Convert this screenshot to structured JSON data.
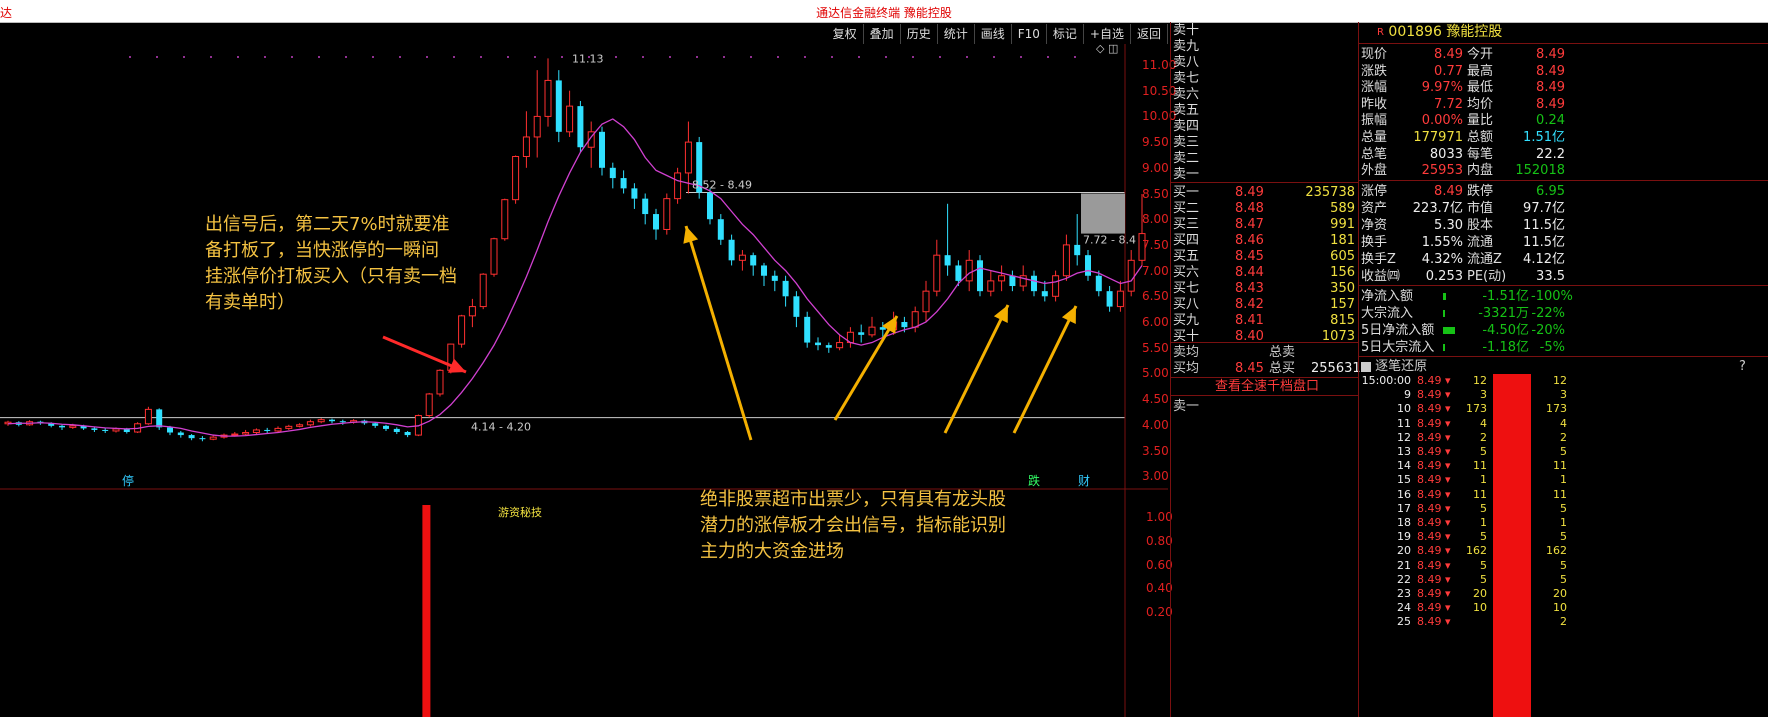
{
  "title_bar": {
    "text": "通达信金融终端  豫能控股",
    "edge": "达"
  },
  "toolbar": [
    "复权",
    "叠加",
    "历史",
    "统计",
    "画线",
    "F10",
    "标记",
    "+自选",
    "返回"
  ],
  "chart": {
    "high_label": "11.13",
    "range_label_low": "4.14 - 4.20",
    "range_label_high": "8.52 - 8.49",
    "right_label": "7.72 - 8.4",
    "markers": {
      "left": "停",
      "mid": "跌",
      "right": "财"
    },
    "indicator_title": "游资秘技",
    "annotation_left": [
      "出信号后，第二天7%时就要准",
      "备打板了，当快涨停的一瞬间",
      "挂涨停价打板买入（只有卖一档",
      "有卖单时）"
    ],
    "annotation_bottom": [
      "绝非股票超市出票少，只有具有龙头股",
      "潜力的涨停板才会出信号，指标能识别",
      "主力的大资金进场"
    ]
  },
  "chart_data": {
    "type": "candlestick",
    "price_axis": {
      "ticks": [
        "11.00",
        "10.50",
        "10.00",
        "9.50",
        "9.00",
        "8.50",
        "8.00",
        "7.50",
        "7.00",
        "6.50",
        "6.00",
        "5.50",
        "5.00",
        "4.50",
        "4.00",
        "3.50",
        "3.00"
      ],
      "min": 3.0,
      "max": 11.0
    },
    "indicator_axis": {
      "ticks": [
        "1.00",
        "0.80",
        "0.60",
        "0.40",
        "0.20"
      ]
    },
    "candles": [
      [
        4.02,
        4.05,
        3.98,
        4.08
      ],
      [
        4.05,
        4.0,
        3.97,
        4.07
      ],
      [
        4.0,
        4.06,
        3.98,
        4.09
      ],
      [
        4.06,
        4.03,
        4.0,
        4.08
      ],
      [
        4.03,
        3.98,
        3.95,
        4.05
      ],
      [
        3.98,
        3.95,
        3.9,
        4.0
      ],
      [
        3.95,
        3.98,
        3.92,
        4.02
      ],
      [
        3.98,
        3.93,
        3.9,
        4.0
      ],
      [
        3.93,
        3.9,
        3.86,
        3.96
      ],
      [
        3.9,
        3.88,
        3.84,
        3.94
      ],
      [
        3.88,
        3.92,
        3.85,
        3.95
      ],
      [
        3.92,
        3.86,
        3.83,
        3.94
      ],
      [
        3.86,
        4.02,
        3.84,
        4.05
      ],
      [
        4.02,
        4.3,
        4.0,
        4.35
      ],
      [
        4.3,
        3.95,
        3.9,
        4.32
      ],
      [
        3.95,
        3.85,
        3.8,
        3.98
      ],
      [
        3.85,
        3.8,
        3.75,
        3.88
      ],
      [
        3.8,
        3.74,
        3.7,
        3.82
      ],
      [
        3.74,
        3.72,
        3.68,
        3.78
      ],
      [
        3.72,
        3.76,
        3.7,
        3.8
      ],
      [
        3.76,
        3.8,
        3.73,
        3.83
      ],
      [
        3.8,
        3.82,
        3.77,
        3.86
      ],
      [
        3.82,
        3.85,
        3.8,
        3.9
      ],
      [
        3.85,
        3.9,
        3.82,
        3.93
      ],
      [
        3.9,
        3.88,
        3.84,
        3.94
      ],
      [
        3.88,
        3.93,
        3.85,
        3.97
      ],
      [
        3.93,
        3.97,
        3.9,
        4.0
      ],
      [
        3.97,
        4.0,
        3.95,
        4.03
      ],
      [
        4.0,
        4.06,
        3.97,
        4.1
      ],
      [
        4.06,
        4.1,
        4.03,
        4.13
      ],
      [
        4.1,
        4.07,
        4.03,
        4.12
      ],
      [
        4.07,
        4.05,
        4.0,
        4.1
      ],
      [
        4.05,
        4.08,
        4.02,
        4.11
      ],
      [
        4.08,
        4.03,
        4.0,
        4.1
      ],
      [
        4.03,
        3.98,
        3.94,
        4.05
      ],
      [
        3.98,
        3.92,
        3.88,
        4.0
      ],
      [
        3.92,
        3.86,
        3.82,
        3.95
      ],
      [
        3.86,
        3.8,
        3.76,
        3.88
      ],
      [
        3.8,
        4.18,
        3.78,
        4.2
      ],
      [
        4.18,
        4.6,
        4.14,
        4.62
      ],
      [
        4.6,
        5.06,
        4.55,
        5.08
      ],
      [
        5.06,
        5.57,
        5.0,
        5.58
      ],
      [
        5.57,
        6.12,
        5.5,
        6.14
      ],
      [
        6.12,
        6.3,
        5.9,
        6.45
      ],
      [
        6.3,
        6.93,
        6.25,
        6.95
      ],
      [
        6.93,
        7.62,
        6.88,
        7.64
      ],
      [
        7.62,
        8.38,
        7.58,
        8.4
      ],
      [
        8.38,
        9.22,
        8.3,
        9.24
      ],
      [
        9.22,
        9.6,
        9.0,
        10.1
      ],
      [
        9.6,
        10.0,
        9.2,
        10.9
      ],
      [
        10.0,
        10.7,
        9.8,
        11.13
      ],
      [
        10.7,
        9.7,
        9.5,
        10.9
      ],
      [
        9.7,
        10.2,
        9.6,
        10.5
      ],
      [
        10.2,
        9.4,
        9.3,
        10.3
      ],
      [
        9.4,
        9.7,
        9.0,
        9.9
      ],
      [
        9.7,
        9.0,
        8.85,
        9.8
      ],
      [
        9.0,
        8.8,
        8.6,
        9.1
      ],
      [
        8.8,
        8.6,
        8.5,
        8.95
      ],
      [
        8.6,
        8.4,
        8.2,
        8.7
      ],
      [
        8.4,
        8.1,
        7.9,
        8.5
      ],
      [
        8.1,
        7.8,
        7.6,
        8.2
      ],
      [
        7.8,
        8.4,
        7.7,
        8.5
      ],
      [
        8.4,
        8.9,
        8.3,
        9.0
      ],
      [
        8.9,
        9.5,
        8.5,
        9.9
      ],
      [
        9.5,
        8.52,
        8.4,
        9.6
      ],
      [
        8.52,
        8.0,
        7.9,
        8.6
      ],
      [
        8.0,
        7.6,
        7.5,
        8.1
      ],
      [
        7.6,
        7.2,
        7.1,
        7.7
      ],
      [
        7.2,
        7.3,
        7.0,
        7.4
      ],
      [
        7.3,
        7.1,
        6.9,
        7.35
      ],
      [
        7.1,
        6.9,
        6.7,
        7.15
      ],
      [
        6.9,
        6.8,
        6.6,
        7.0
      ],
      [
        6.8,
        6.5,
        6.3,
        6.9
      ],
      [
        6.5,
        6.1,
        5.9,
        6.6
      ],
      [
        6.1,
        5.6,
        5.5,
        6.2
      ],
      [
        5.6,
        5.55,
        5.45,
        5.7
      ],
      [
        5.55,
        5.5,
        5.4,
        5.6
      ],
      [
        5.5,
        5.6,
        5.45,
        5.75
      ],
      [
        5.6,
        5.8,
        5.5,
        5.9
      ],
      [
        5.8,
        5.75,
        5.6,
        5.95
      ],
      [
        5.75,
        5.9,
        5.7,
        6.1
      ],
      [
        5.9,
        5.85,
        5.7,
        6.0
      ],
      [
        5.85,
        6.0,
        5.75,
        6.2
      ],
      [
        6.0,
        5.9,
        5.8,
        6.1
      ],
      [
        5.9,
        6.2,
        5.8,
        6.3
      ],
      [
        6.2,
        6.6,
        6.0,
        6.8
      ],
      [
        6.6,
        7.3,
        6.5,
        7.6
      ],
      [
        7.3,
        7.1,
        6.9,
        8.3
      ],
      [
        7.1,
        6.8,
        6.7,
        7.2
      ],
      [
        6.8,
        7.2,
        6.6,
        7.4
      ],
      [
        7.2,
        6.6,
        6.5,
        7.3
      ],
      [
        6.6,
        6.8,
        6.5,
        7.0
      ],
      [
        6.8,
        6.9,
        6.6,
        7.1
      ],
      [
        6.9,
        6.7,
        6.6,
        7.0
      ],
      [
        6.7,
        6.9,
        6.6,
        7.1
      ],
      [
        6.9,
        6.6,
        6.5,
        7.0
      ],
      [
        6.6,
        6.5,
        6.4,
        6.8
      ],
      [
        6.5,
        6.9,
        6.4,
        7.0
      ],
      [
        6.9,
        7.5,
        6.8,
        7.7
      ],
      [
        7.5,
        7.3,
        7.1,
        8.1
      ],
      [
        7.3,
        6.9,
        6.8,
        7.4
      ],
      [
        6.9,
        6.6,
        6.5,
        7.0
      ],
      [
        6.6,
        6.3,
        6.2,
        6.7
      ],
      [
        6.3,
        6.6,
        6.2,
        6.8
      ],
      [
        6.6,
        7.2,
        6.5,
        7.4
      ],
      [
        7.2,
        7.72,
        7.1,
        8.49
      ]
    ],
    "ma": [
      4.02,
      4.03,
      4.03,
      4.04,
      4.03,
      4.01,
      4.0,
      3.98,
      3.96,
      3.94,
      3.93,
      3.92,
      3.93,
      3.97,
      3.98,
      3.96,
      3.93,
      3.88,
      3.84,
      3.8,
      3.78,
      3.78,
      3.79,
      3.81,
      3.83,
      3.85,
      3.88,
      3.91,
      3.95,
      3.98,
      4.01,
      4.03,
      4.05,
      4.06,
      4.05,
      4.03,
      4.0,
      3.96,
      3.98,
      4.07,
      4.2,
      4.39,
      4.63,
      4.9,
      5.21,
      5.55,
      5.95,
      6.4,
      6.88,
      7.4,
      7.95,
      8.45,
      8.9,
      9.3,
      9.6,
      9.85,
      9.95,
      9.8,
      9.55,
      9.2,
      8.95,
      8.85,
      8.75,
      8.7,
      8.65,
      8.55,
      8.4,
      8.15,
      7.9,
      7.7,
      7.45,
      7.2,
      7.0,
      6.75,
      6.45,
      6.2,
      5.95,
      5.75,
      5.6,
      5.55,
      5.6,
      5.7,
      5.78,
      5.85,
      5.9,
      6.0,
      6.2,
      6.45,
      6.75,
      6.95,
      7.05,
      7.0,
      6.95,
      6.9,
      6.85,
      6.8,
      6.75,
      6.78,
      6.85,
      6.95,
      7.0,
      6.95,
      6.85,
      6.75,
      6.8,
      7.1
    ],
    "indicator_bars": [
      {
        "index": 38,
        "value": 1.0
      }
    ]
  },
  "quote": {
    "code": "001896",
    "name": "豫能控股",
    "badge": "R",
    "ask_labels": [
      "卖十",
      "卖九",
      "卖八",
      "卖七",
      "卖六",
      "卖五",
      "卖四",
      "卖三",
      "卖二",
      "卖一"
    ],
    "bids": [
      {
        "label": "买一",
        "price": "8.49",
        "vol": "235738"
      },
      {
        "label": "买二",
        "price": "8.48",
        "vol": "589"
      },
      {
        "label": "买三",
        "price": "8.47",
        "vol": "991"
      },
      {
        "label": "买四",
        "price": "8.46",
        "vol": "181"
      },
      {
        "label": "买五",
        "price": "8.45",
        "vol": "605"
      },
      {
        "label": "买六",
        "price": "8.44",
        "vol": "156"
      },
      {
        "label": "买七",
        "price": "8.43",
        "vol": "350"
      },
      {
        "label": "买八",
        "price": "8.42",
        "vol": "157"
      },
      {
        "label": "买九",
        "price": "8.41",
        "vol": "815"
      },
      {
        "label": "买十",
        "price": "8.40",
        "vol": "1073"
      }
    ],
    "avg": {
      "sell_avg": "卖均",
      "total_sell": "总卖",
      "buy_avg": "买均",
      "buy_avg_val": "8.45",
      "total_buy": "总买",
      "total_buy_val": "255631"
    },
    "full_depth_link": "查看全速千档盘口",
    "sell_one": "卖一",
    "stats": [
      [
        "现价",
        "8.49",
        "今开",
        "8.49"
      ],
      [
        "涨跌",
        "0.77",
        "最高",
        "8.49"
      ],
      [
        "涨幅",
        "9.97%",
        "最低",
        "8.49"
      ],
      [
        "昨收",
        "7.72",
        "均价",
        "8.49"
      ],
      [
        "振幅",
        "0.00%",
        "量比",
        "0.24"
      ],
      [
        "总量",
        "177971",
        "总额",
        "1.51亿"
      ],
      [
        "总笔",
        "8033",
        "每笔",
        "22.2"
      ],
      [
        "外盘",
        "25953",
        "内盘",
        "152018"
      ]
    ],
    "stats2": [
      [
        "涨停",
        "8.49",
        "跌停",
        "6.95"
      ],
      [
        "资产",
        "223.7亿",
        "市值",
        "97.7亿"
      ],
      [
        "净资",
        "5.30",
        "股本",
        "11.5亿"
      ],
      [
        "换手",
        "1.55%",
        "流通",
        "11.5亿"
      ],
      [
        "换手Z",
        "4.32%",
        "流通Z",
        "4.12亿"
      ],
      [
        "收益㈣",
        "0.253",
        "PE(动)",
        "33.5"
      ]
    ],
    "flows": [
      [
        "净流入额",
        "-1.51亿",
        "-100%"
      ],
      [
        "大宗流入",
        "-3321万",
        "-22%"
      ],
      [
        "5日净流入额",
        "-4.50亿",
        "-20%"
      ],
      [
        "5日大宗流入",
        "-1.18亿",
        "-5%"
      ]
    ],
    "ticks_title": "逐笔还原",
    "ticks_help": "?",
    "ticks": [
      [
        "15:00:00",
        "8.49",
        "12",
        "12"
      ],
      [
        "9",
        "8.49",
        "3",
        "3"
      ],
      [
        "10",
        "8.49",
        "173",
        "173"
      ],
      [
        "11",
        "8.49",
        "4",
        "4"
      ],
      [
        "12",
        "8.49",
        "2",
        "2"
      ],
      [
        "13",
        "8.49",
        "5",
        "5"
      ],
      [
        "14",
        "8.49",
        "11",
        "11"
      ],
      [
        "15",
        "8.49",
        "1",
        "1"
      ],
      [
        "16",
        "8.49",
        "11",
        "11"
      ],
      [
        "17",
        "8.49",
        "5",
        "5"
      ],
      [
        "18",
        "8.49",
        "1",
        "1"
      ],
      [
        "19",
        "8.49",
        "5",
        "5"
      ],
      [
        "20",
        "8.49",
        "162",
        "162"
      ],
      [
        "21",
        "8.49",
        "5",
        "5"
      ],
      [
        "22",
        "8.49",
        "5",
        "5"
      ],
      [
        "23",
        "8.49",
        "20",
        "20"
      ],
      [
        "24",
        "8.49",
        "10",
        "10"
      ],
      [
        "25",
        "8.49",
        "",
        "2"
      ]
    ]
  }
}
